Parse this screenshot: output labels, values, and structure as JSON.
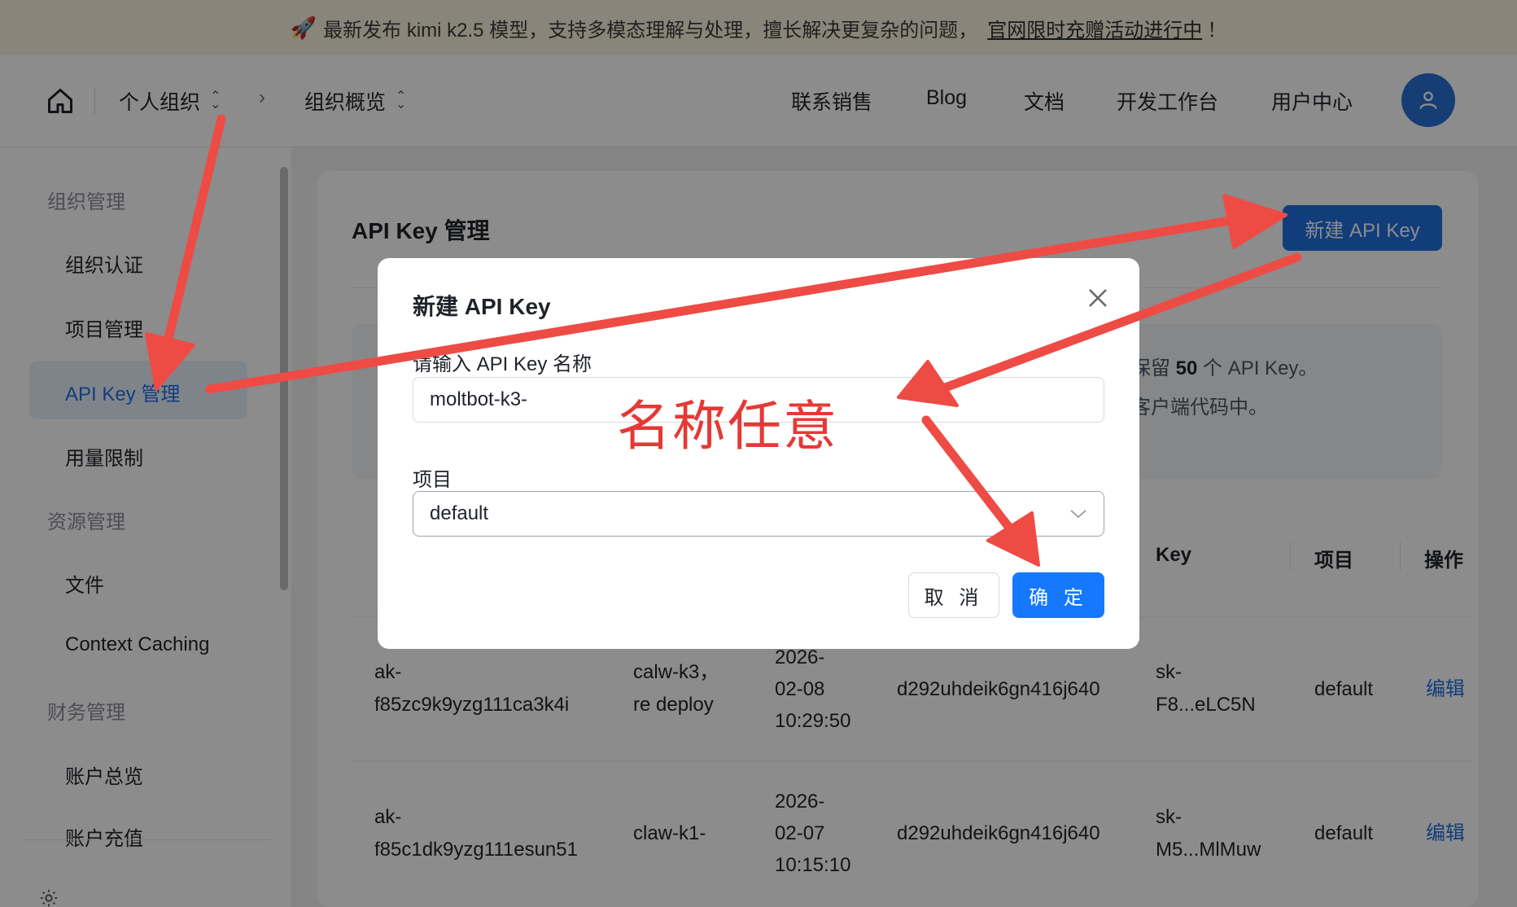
{
  "banner": {
    "text": "最新发布 kimi k2.5 模型，支持多模态理解与处理，擅长解决更复杂的问题，",
    "link": "官网限时充赠活动进行中",
    "suffix": "！"
  },
  "header": {
    "breadcrumb": [
      "个人组织",
      "组织概览"
    ],
    "nav": [
      "联系销售",
      "Blog",
      "文档",
      "开发工作台",
      "用户中心"
    ]
  },
  "sidebar": {
    "groups": {
      "org": "组织管理",
      "resource": "资源管理",
      "finance": "财务管理"
    },
    "items": [
      "组织认证",
      "项目管理",
      "API Key 管理",
      "用量限制",
      "文件",
      "Context Caching",
      "账户总览",
      "账户充值"
    ]
  },
  "page": {
    "title": "API Key 管理",
    "new_button": "新建 API Key"
  },
  "notice": {
    "line1_prefix": "保留 ",
    "line1_count": "50",
    "line1_suffix": " 个 API Key。",
    "line2": "客户端代码中。"
  },
  "table": {
    "headers": [
      "Key",
      "项目",
      "操作"
    ],
    "rows": [
      {
        "id_l1": "ak-",
        "id_l2": "f85zc9k9yzg111ca3k4i",
        "name_l1": "calw-k3，",
        "name_l2": "re deploy",
        "date": "2026-",
        "date2": "02-08",
        "time": "10:29:50",
        "creator": "d292uhdeik6gn416j640",
        "key_l1": "sk-",
        "key_l2": "F8...eLC5N",
        "project": "default",
        "action": "编辑"
      },
      {
        "id_l1": "ak-",
        "id_l2": "f85c1dk9yzg111esun51",
        "name_l1": "claw-k1-",
        "name_l2": "",
        "date": "2026-",
        "date2": "02-07",
        "time": "10:15:10",
        "creator": "d292uhdeik6gn416j640",
        "key_l1": "sk-",
        "key_l2": "M5...MlMuw",
        "project": "default",
        "action": "编辑"
      }
    ]
  },
  "modal": {
    "title": "新建 API Key",
    "name_label": "请输入 API Key 名称",
    "name_value": "moltbot-k3-",
    "project_label": "项目",
    "project_value": "default",
    "cancel": "取 消",
    "ok": "确 定"
  },
  "annotation": {
    "text": "名称任意",
    "color": "#e53935"
  },
  "colors": {
    "primary": "#1f6fe0",
    "banner_bg": "#fbf3df",
    "annotation": "#e53935"
  }
}
